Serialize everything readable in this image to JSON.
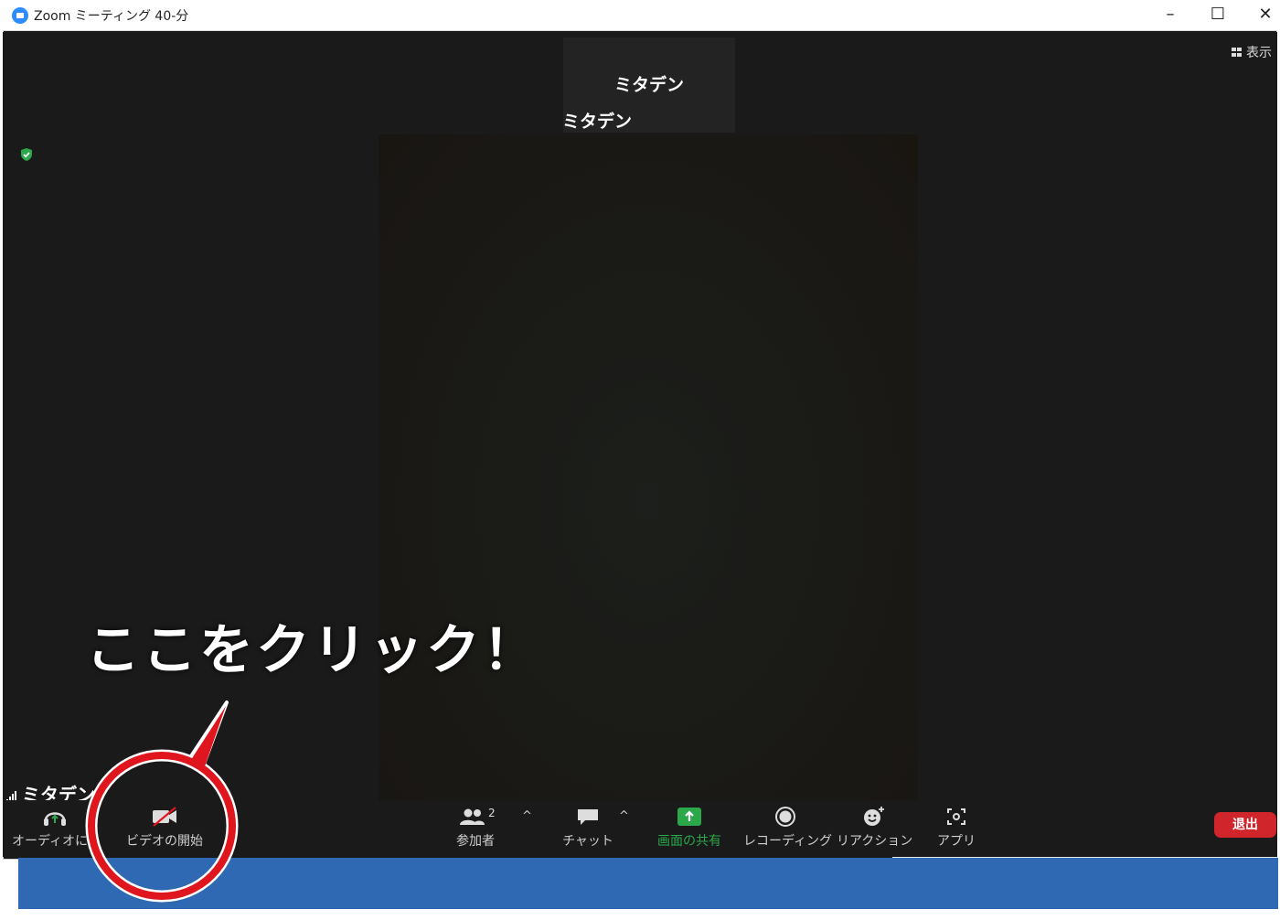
{
  "window": {
    "title": "Zoom ミーティング 40-分",
    "minimize": "–",
    "maximize": "☐",
    "close": "✕"
  },
  "meeting": {
    "view_button": "表示",
    "active_speaker_name": "ミタデン",
    "active_speaker_label": "ミタデン",
    "self_name": "ミタデン",
    "security_color": "#2aa84a"
  },
  "toolbar": {
    "audio": "オーディオに接",
    "video": "ビデオの開始",
    "participants": "参加者",
    "participants_count": "2",
    "chat": "チャット",
    "share": "画面の共有",
    "record": "レコーディング",
    "reactions": "リアクション",
    "apps": "アプリ",
    "leave": "退出",
    "caret": "^"
  },
  "annotation": {
    "text": "ここをクリック！",
    "ring_color": "#e0161e"
  }
}
